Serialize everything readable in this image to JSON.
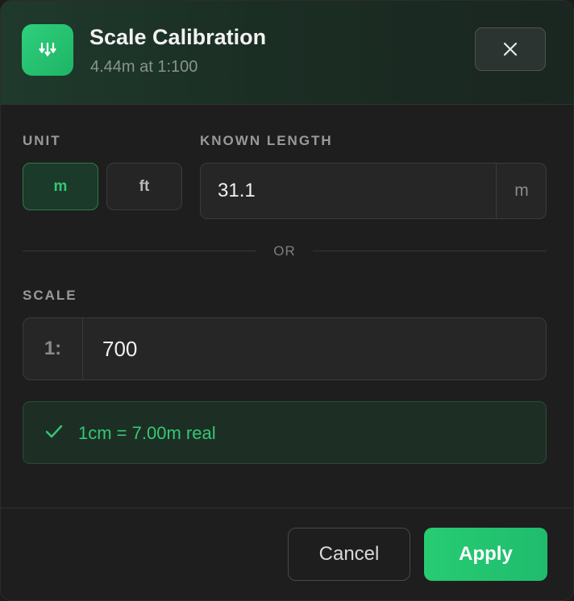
{
  "header": {
    "icon": "ruler-calibrate-icon",
    "title": "Scale Calibration",
    "subtitle": "4.44m at 1:100",
    "close_icon": "close-icon"
  },
  "unit": {
    "label": "UNIT",
    "options": [
      "m",
      "ft"
    ],
    "selected": "m"
  },
  "known_length": {
    "label": "KNOWN LENGTH",
    "value": "31.1",
    "unit_suffix": "m"
  },
  "divider": {
    "text": "OR"
  },
  "scale": {
    "label": "SCALE",
    "prefix": "1:",
    "value": "700"
  },
  "result": {
    "icon": "check-icon",
    "text": "1cm = 7.00m real"
  },
  "footer": {
    "cancel_label": "Cancel",
    "apply_label": "Apply"
  },
  "colors": {
    "accent": "#2ecc71",
    "background": "#1e1e1e",
    "header_tint": "#1f3a2c",
    "muted_text": "#9a9a9a"
  }
}
